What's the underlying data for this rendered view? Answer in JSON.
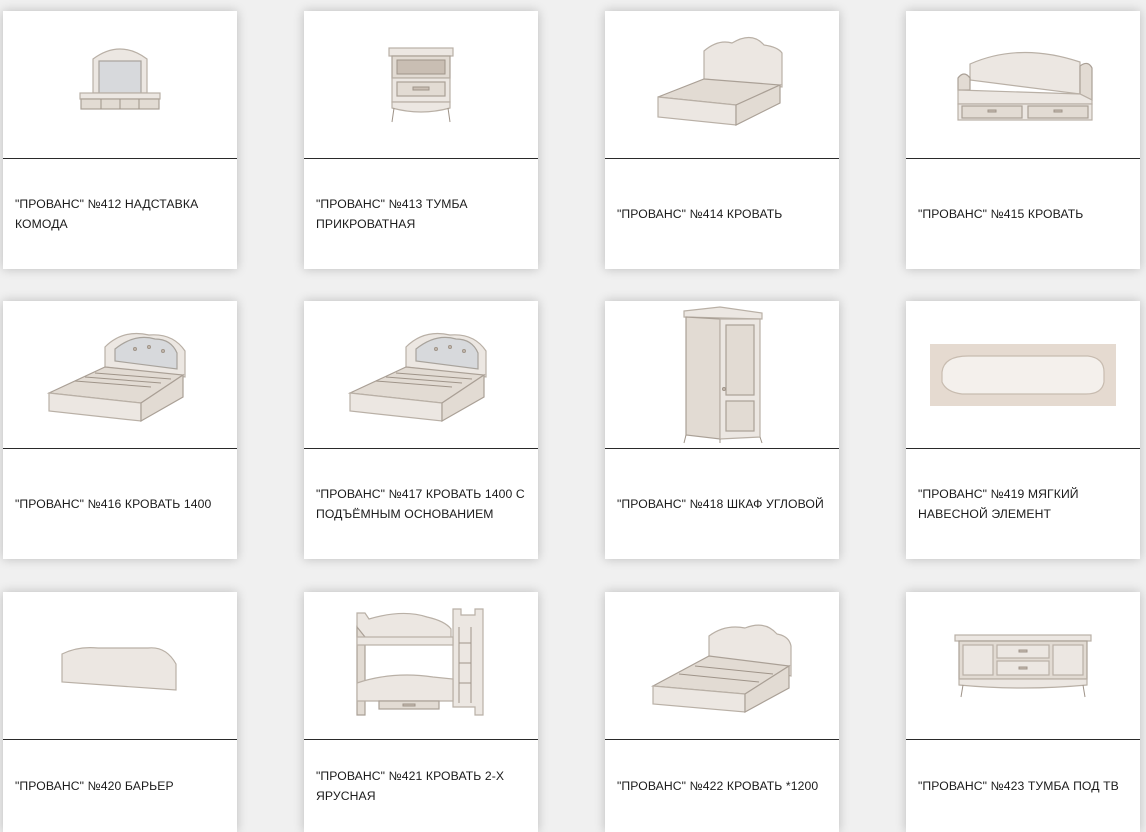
{
  "products": [
    {
      "id": "p412",
      "icon": "dresser-mirror-topper-icon",
      "title": "\"ПРОВАНС\" №412 НАДСТАВКА КОМОДА"
    },
    {
      "id": "p413",
      "icon": "nightstand-icon",
      "title": "\"ПРОВАНС\" №413 ТУМБА ПРИКРОВАТНАЯ"
    },
    {
      "id": "p414",
      "icon": "single-bed-icon",
      "title": "\"ПРОВАНС\" №414 КРОВАТЬ"
    },
    {
      "id": "p415",
      "icon": "daybed-icon",
      "title": "\"ПРОВАНС\" №415 КРОВАТЬ"
    },
    {
      "id": "p416",
      "icon": "tufted-bed-icon",
      "title": "\"ПРОВАНС\" №416 КРОВАТЬ 1400"
    },
    {
      "id": "p417",
      "icon": "tufted-bed-lift-icon",
      "title": "\"ПРОВАНС\" №417 КРОВАТЬ 1400 С ПОДЪЁМНЫМ ОСНОВАНИЕМ"
    },
    {
      "id": "p418",
      "icon": "corner-wardrobe-icon",
      "title": "\"ПРОВАНС\" №418 ШКАФ УГЛОВОЙ"
    },
    {
      "id": "p419",
      "icon": "wall-panel-icon",
      "title": "\"ПРОВАНС\" №419 МЯГКИЙ НАВЕСНОЙ ЭЛЕМЕНТ"
    },
    {
      "id": "p420",
      "icon": "bed-barrier-icon",
      "title": "\"ПРОВАНС\" №420 БАРЬЕР"
    },
    {
      "id": "p421",
      "icon": "bunk-bed-icon",
      "title": "\"ПРОВАНС\" №421 КРОВАТЬ 2-Х ЯРУСНАЯ"
    },
    {
      "id": "p422",
      "icon": "bed-1200-icon",
      "title": "\"ПРОВАНС\" №422 КРОВАТЬ *1200"
    },
    {
      "id": "p423",
      "icon": "tv-stand-icon",
      "title": "\"ПРОВАНС\" №423 ТУМБА ПОД ТВ"
    }
  ]
}
